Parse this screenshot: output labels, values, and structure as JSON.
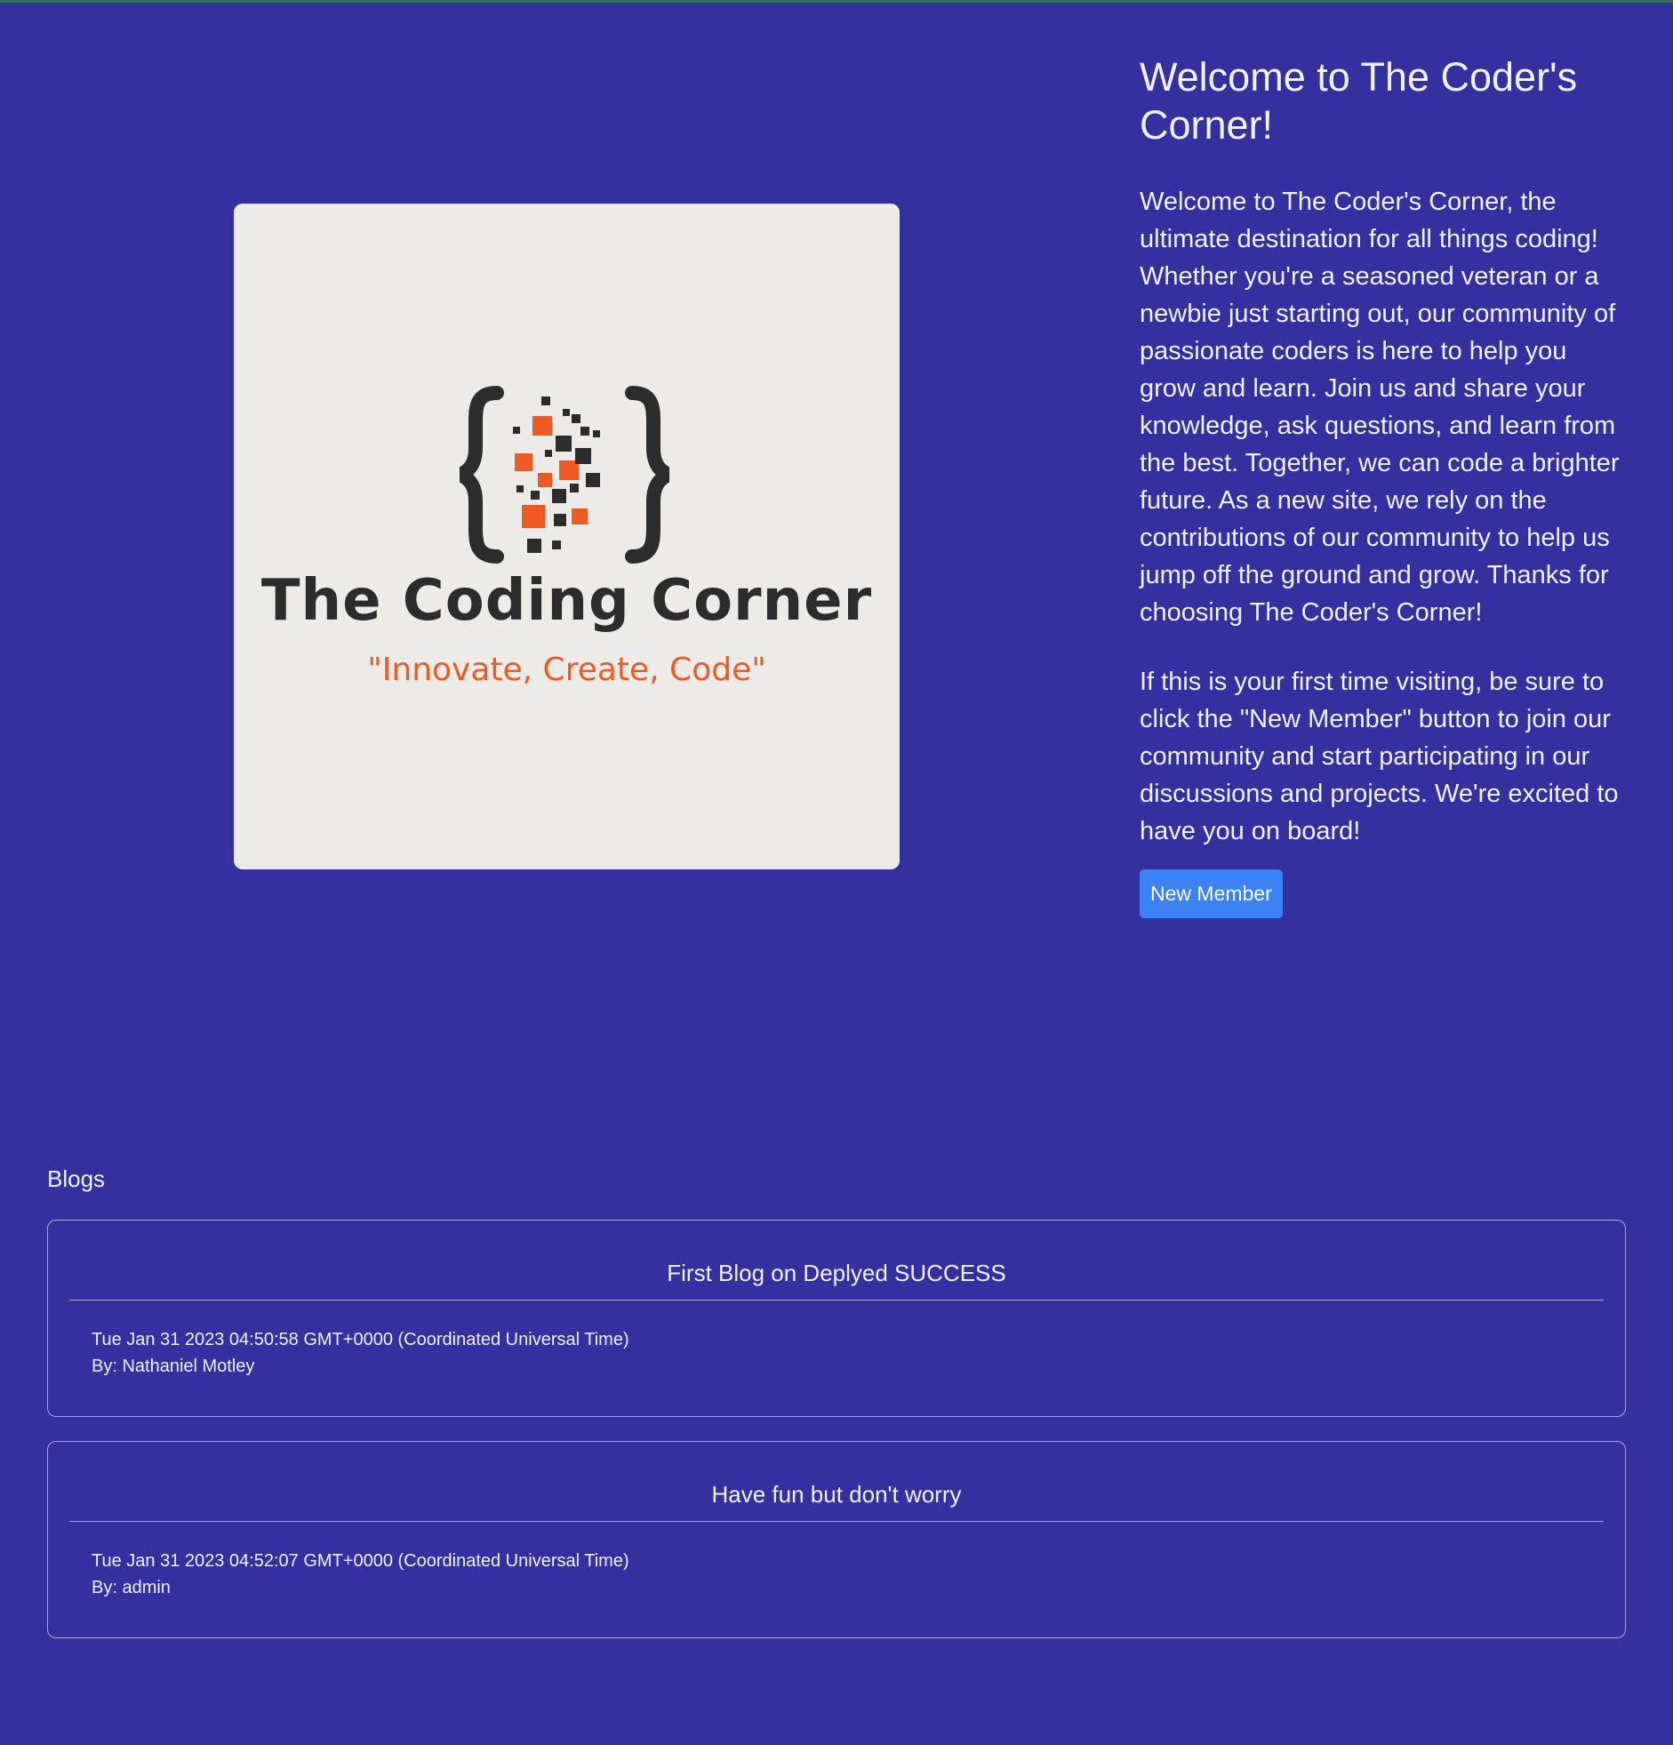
{
  "colors": {
    "page_background": "#3530a0",
    "button_background": "#3b82f6",
    "logo_card_background": "#edebe7",
    "logo_accent": "#ef5a22",
    "logo_dark": "#2c2c2c"
  },
  "logo": {
    "title": "The Coding Corner",
    "tagline": "\"Innovate, Create, Code\"",
    "icon": "braces-pixels-icon"
  },
  "welcome": {
    "title": "Welcome to The Coder's Corner!",
    "paragraph_1": "Welcome to The Coder's Corner, the ultimate destination for all things coding! Whether you're a seasoned veteran or a newbie just starting out, our community of passionate coders is here to help you grow and learn. Join us and share your knowledge, ask questions, and learn from the best. Together, we can code a brighter future. As a new site, we rely on the contributions of our community to help us jump off the ground and grow. Thanks for choosing The Coder's Corner!",
    "paragraph_2": "If this is your first time visiting, be sure to click the \"New Member\" button to join our community and start participating in our discussions and projects. We're excited to have you on board!",
    "button_label": "New Member"
  },
  "blogs": {
    "heading": "Blogs",
    "items": [
      {
        "title": "First Blog on Deplyed SUCCESS",
        "date": "Tue Jan 31 2023 04:50:58 GMT+0000 (Coordinated Universal Time)",
        "author": "By: Nathaniel Motley"
      },
      {
        "title": "Have fun but don't worry",
        "date": "Tue Jan 31 2023 04:52:07 GMT+0000 (Coordinated Universal Time)",
        "author": "By: admin"
      }
    ]
  }
}
